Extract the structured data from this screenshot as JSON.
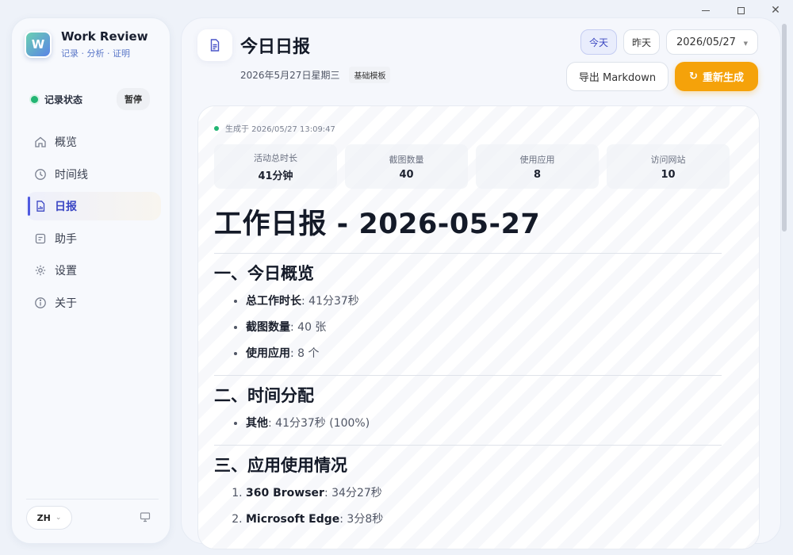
{
  "window": {
    "minimize": "—",
    "maximize": "☐",
    "close": "✕"
  },
  "brand": {
    "logo_text": "W",
    "name": "Work Review",
    "tagline": "记录 · 分析 · 证明"
  },
  "recording": {
    "label": "记录状态",
    "pause_label": "暂停",
    "status_color": "#22b573"
  },
  "nav": {
    "items": [
      {
        "label": "概览",
        "icon": "home-icon"
      },
      {
        "label": "时间线",
        "icon": "clock-icon"
      },
      {
        "label": "日报",
        "icon": "report-icon",
        "active": true
      },
      {
        "label": "助手",
        "icon": "assistant-icon"
      },
      {
        "label": "设置",
        "icon": "gear-icon"
      },
      {
        "label": "关于",
        "icon": "info-icon"
      }
    ]
  },
  "footer": {
    "language": "ZH",
    "chevron": "⌄"
  },
  "header": {
    "title": "今日日报",
    "date_text": "2026年5月27日星期三",
    "template_badge": "基础模板",
    "today_label": "今天",
    "yesterday_label": "昨天",
    "date_value": "2026/05/27",
    "caret": "▼",
    "export_label": "导出 Markdown",
    "regen_label": "重新生成",
    "regen_icon": "↻",
    "accent_color": "#f5a20a"
  },
  "report_meta": {
    "generated": "生成于 2026/05/27 13:09:47",
    "stats": [
      {
        "label": "活动总时长",
        "value": "41分钟"
      },
      {
        "label": "截图数量",
        "value": "40"
      },
      {
        "label": "使用应用",
        "value": "8"
      },
      {
        "label": "访问网站",
        "value": "10"
      }
    ]
  },
  "report": {
    "h1": "工作日报 - 2026-05-27",
    "s1": {
      "title": "一、今日概览",
      "items": [
        {
          "key": "总工作时长",
          "value": ": 41分37秒"
        },
        {
          "key": "截图数量",
          "value": ": 40 张"
        },
        {
          "key": "使用应用",
          "value": ": 8 个"
        }
      ]
    },
    "s2": {
      "title": "二、时间分配",
      "items": [
        {
          "key": "其他",
          "value": ": 41分37秒 (100%)"
        }
      ]
    },
    "s3": {
      "title": "三、应用使用情况",
      "items": [
        {
          "key": "360 Browser",
          "value": ": 34分27秒"
        },
        {
          "key": "Microsoft Edge",
          "value": ": 3分8秒"
        }
      ]
    }
  }
}
